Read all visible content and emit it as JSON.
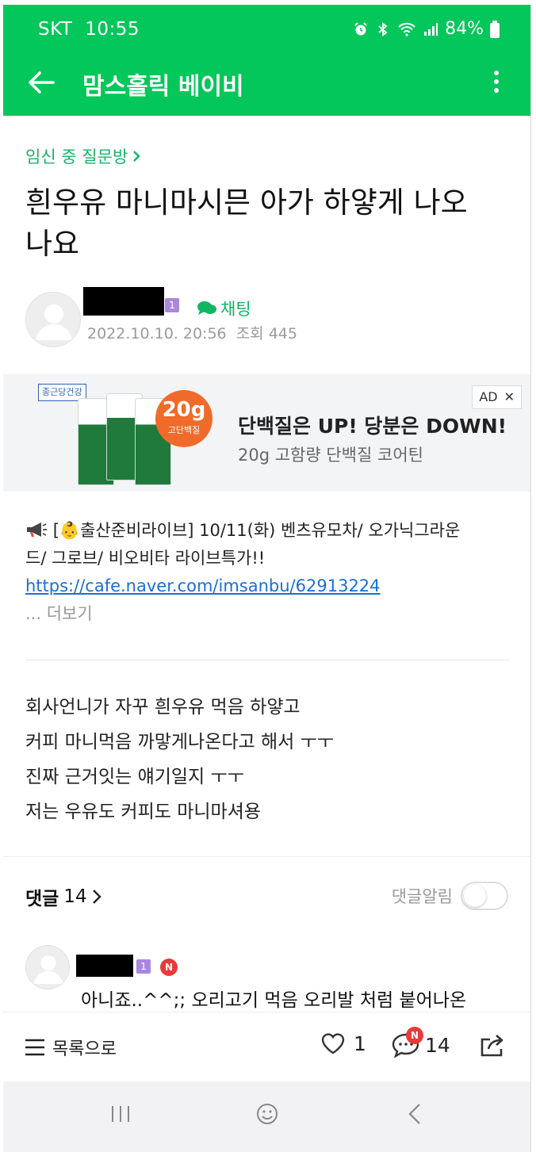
{
  "status_bar": {
    "carrier": "SKT",
    "time": "10:55",
    "battery": "84%"
  },
  "app_bar": {
    "title": "맘스홀릭 베이비"
  },
  "post": {
    "board": "임신 중 질문방",
    "title_line1": "흰우유 마니마시믄 아가 하얗게 나오",
    "title_line2": "나요",
    "author_level": "1",
    "chat_label": "채팅",
    "date": "2022.10.10. 20:56",
    "views_label": "조회",
    "views": "445"
  },
  "ad": {
    "brand": "종근당건강",
    "badge_value": "20g",
    "badge_label": "고단백질",
    "headline": "단백질은 UP! 당분은 DOWN!",
    "subline": "20g 고함량 단백질 코어틴",
    "tag": "AD",
    "close": "✕",
    "colors": {
      "badge": "#f06a2a",
      "pack": "#1f7a3c"
    }
  },
  "notice": {
    "text_line1": "[👶출산준비라이브] 10/11(화) 벤츠유모차/ 오가닉그라운",
    "text_line2": "드/ 그로브/ 비오비타 라이브특가!!",
    "link": "https://cafe.naver.com/imsanbu/62913224",
    "more": "... 더보기"
  },
  "body": {
    "lines": [
      "회사언니가 자꾸 흰우유 먹음 하얗고",
      "커피 마니먹음 까맣게나온다고 해서 ㅜㅜ",
      "진짜 근거잇는 얘기일지 ㅜㅜ",
      "저는 우유도 커피도 마니마셔용"
    ]
  },
  "comments": {
    "label": "댓글",
    "count": "14",
    "notify_label": "댓글알림",
    "first": {
      "level": "1",
      "new_badge": "N",
      "text": "아니죠..^^;; 오리고기 먹음 오리발 처럼 붙어나온"
    }
  },
  "actions": {
    "list_label": "목록으로",
    "likes": "1",
    "comment_count": "14",
    "comment_badge": "N"
  },
  "icons": [
    "alarm-icon",
    "bluetooth-icon",
    "wifi-icon",
    "signal-icon",
    "battery-icon",
    "back-arrow-icon",
    "more-vertical-icon",
    "chevron-right-icon",
    "chat-bubble-icon",
    "megaphone-icon",
    "menu-lines-icon",
    "heart-icon",
    "comment-icon",
    "share-icon",
    "recent-apps-icon",
    "home-icon",
    "nav-back-icon"
  ],
  "colors": {
    "brand_green": "#03c75a",
    "link_blue": "#1a6fd4",
    "badge_purple": "#a987e0",
    "new_red": "#e83a3a"
  }
}
